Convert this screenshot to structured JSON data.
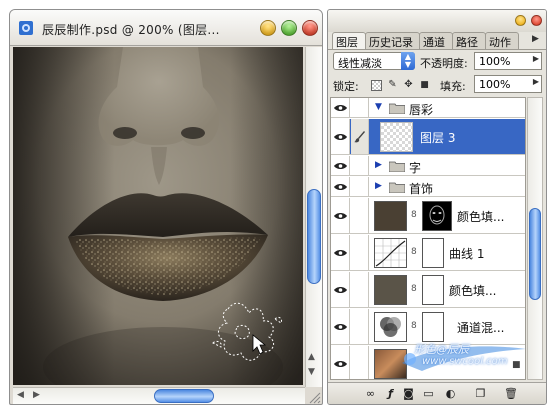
{
  "document": {
    "title": "辰辰制作.psd @ 200% (图层..."
  },
  "layers_panel": {
    "tabs": [
      "图层",
      "历史记录",
      "通道",
      "路径",
      "动作"
    ],
    "active_tab": "图层",
    "blend_mode": "线性减淡",
    "opacity_label": "不透明度:",
    "opacity_value": "100%",
    "lock_label": "锁定:",
    "fill_label": "填充:",
    "fill_value": "100%",
    "layers": [
      {
        "name": "唇彩",
        "kind": "group",
        "expanded": true
      },
      {
        "name": "图层 3",
        "kind": "layer",
        "selected": true
      },
      {
        "name": "字",
        "kind": "group",
        "expanded": false
      },
      {
        "name": "首饰",
        "kind": "group",
        "expanded": false
      },
      {
        "name": "颜色填...",
        "kind": "fill-adjustment"
      },
      {
        "name": "曲线 1",
        "kind": "curves-adjustment"
      },
      {
        "name": "颜色填...",
        "kind": "fill-adjustment"
      },
      {
        "name": "通道混...",
        "kind": "channel-mixer-adjustment"
      },
      {
        "name": "",
        "kind": "image-layer"
      }
    ]
  },
  "watermark": {
    "line1": "形色@辰辰",
    "line2": "www.swcool.com"
  },
  "colors": {
    "selection": "#3867c4",
    "scroll_thumb": "#4c88e0",
    "canvas_dark": "#3a362f",
    "skin": "#8b8374"
  },
  "icons": {
    "title_buttons": [
      "minimize-icon",
      "maximize-icon",
      "close-icon"
    ],
    "bottom_bar": [
      "link-layers-icon",
      "layer-style-icon",
      "add-mask-icon",
      "new-group-icon",
      "new-adjustment-icon",
      "new-layer-icon",
      "delete-layer-icon"
    ]
  }
}
